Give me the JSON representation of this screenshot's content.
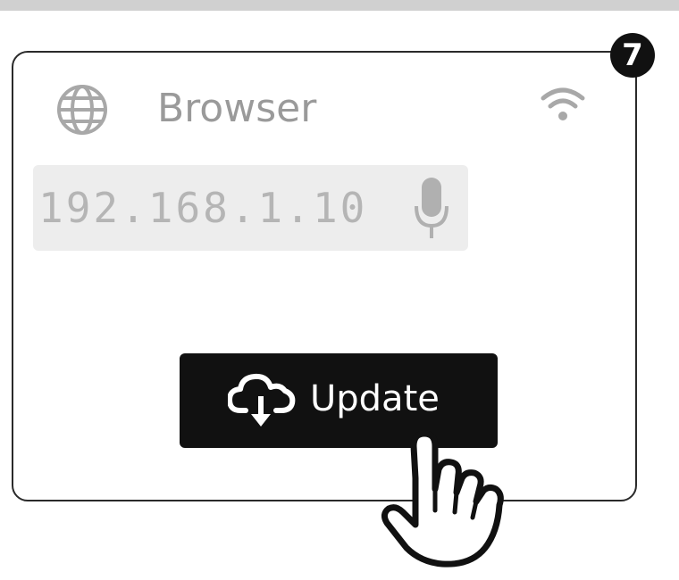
{
  "step": {
    "number": "7"
  },
  "header": {
    "title": "Browser",
    "icon": "globe-icon",
    "status_icon": "wifi-icon"
  },
  "address_bar": {
    "value": "192.168.1.10",
    "icon": "microphone-icon"
  },
  "update_button": {
    "label": "Update",
    "icon": "cloud-download-icon"
  },
  "pointer": {
    "icon": "hand-pointer-icon"
  },
  "colors": {
    "button_bg": "#111111",
    "button_text": "#ffffff",
    "muted_text": "#9a9a9a",
    "field_bg": "#ededed",
    "badge_bg": "#111111"
  }
}
